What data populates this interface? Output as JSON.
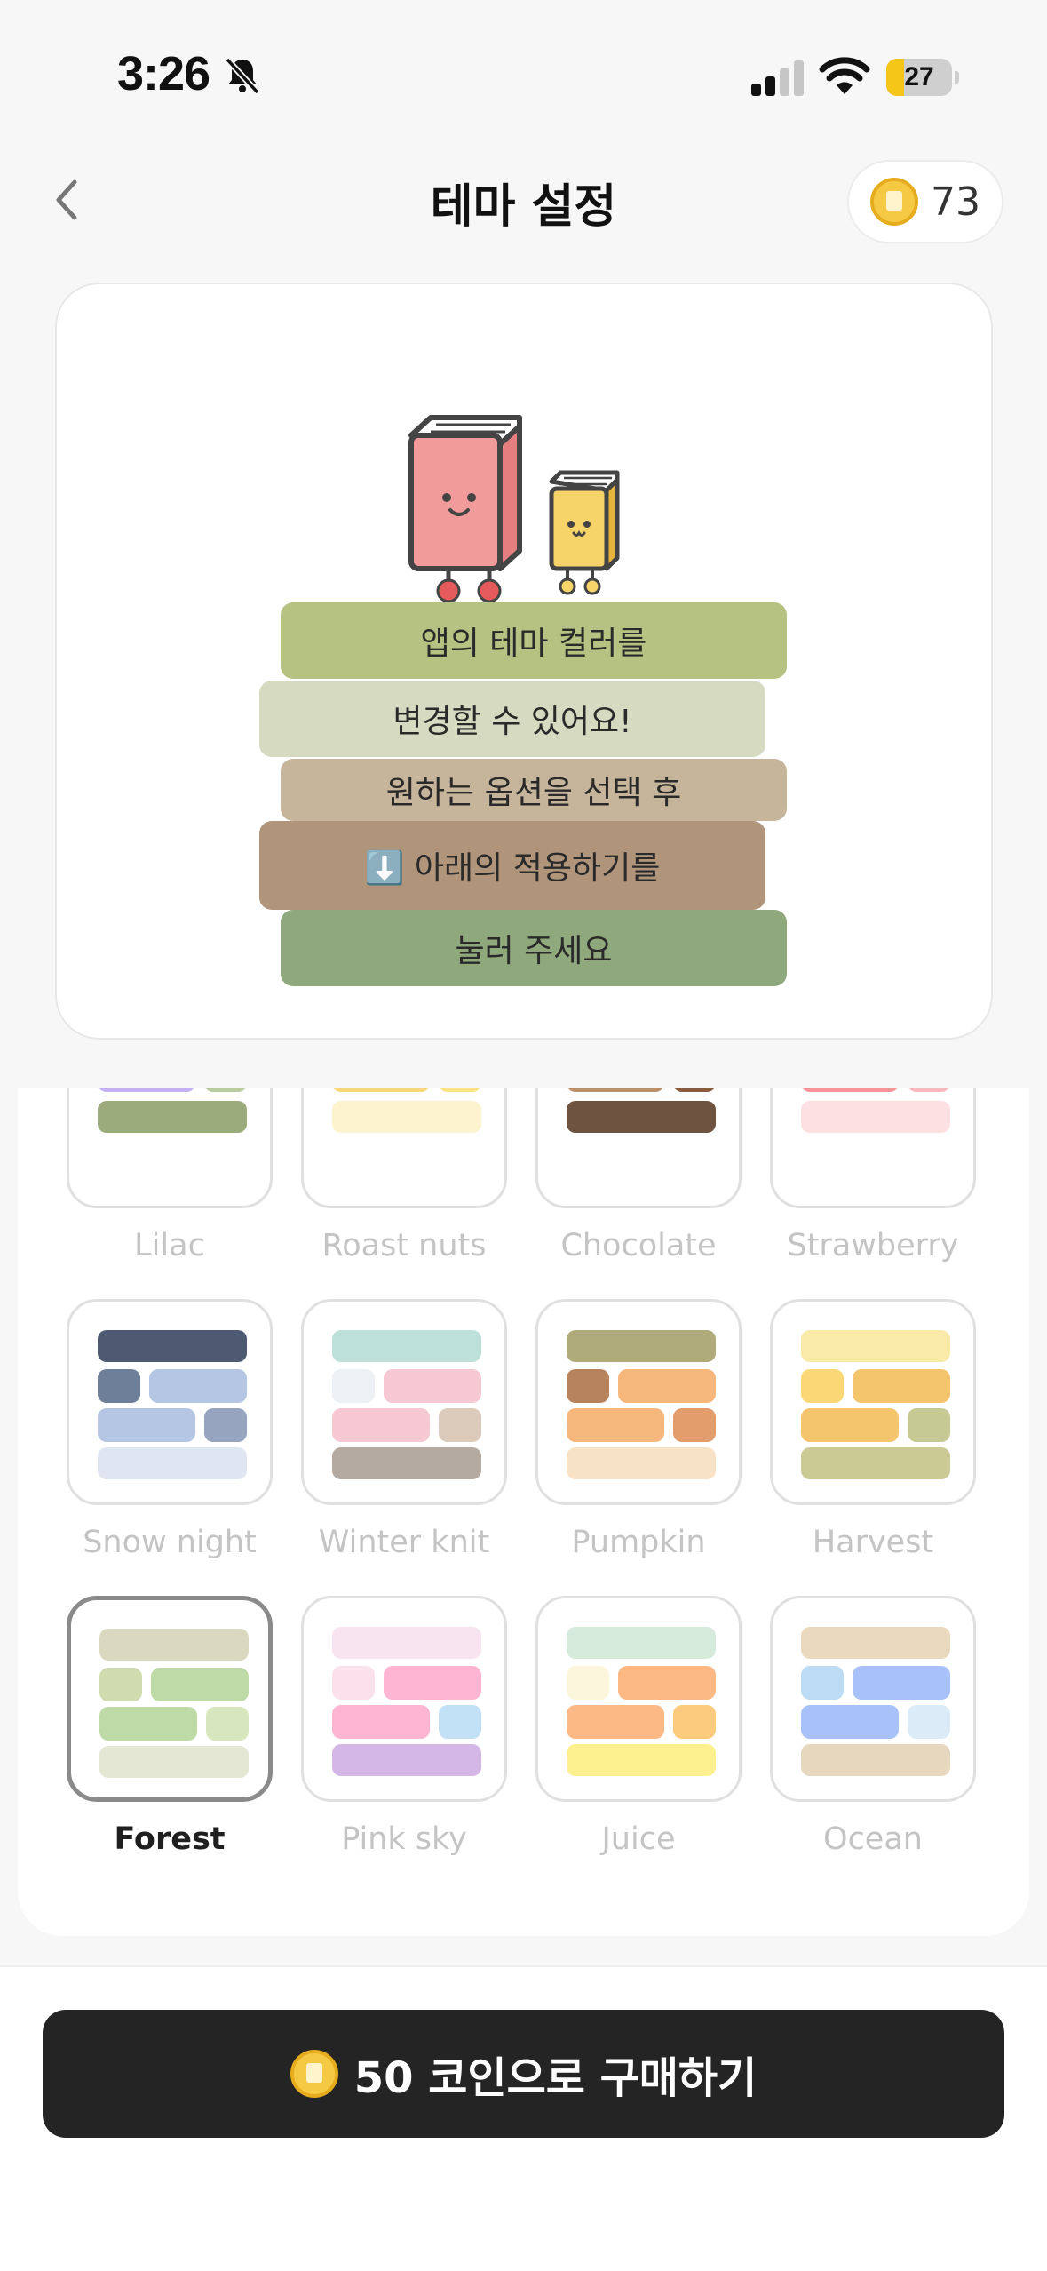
{
  "status_bar": {
    "time": "3:26",
    "battery": "27",
    "battery_level": 0.27,
    "icons": [
      "bell-slash-icon",
      "cellular-signal-icon",
      "wifi-icon",
      "battery-icon"
    ]
  },
  "header": {
    "title": "테마 설정",
    "back_icon": "chevron-left-icon",
    "coin_count": "73"
  },
  "preview": {
    "lines": [
      "앱의 테마 컬러를",
      "변경할 수 있어요!",
      "원하는 옵션을 선택 후",
      "⬇️ 아래의 적용하기를",
      "눌러 주세요"
    ],
    "bar_colors": [
      "#b5c281",
      "#d5dac0",
      "#c6b59a",
      "#b0957b",
      "#90a97c"
    ]
  },
  "themes": [
    {
      "name": "Lilac",
      "selected": false,
      "colors": [
        "#ddd5f0",
        "#c4b1f4",
        "#c4b1f4",
        "#bacb9e",
        "#9bab7c"
      ]
    },
    {
      "name": "Roast nuts",
      "selected": false,
      "colors": [
        "#d8b58a",
        "#f8d779",
        "#f8d779",
        "#fbe383",
        "#fdf4cf"
      ]
    },
    {
      "name": "Chocolate",
      "selected": false,
      "colors": [
        "#e3c9ad",
        "#bb8f6a",
        "#bb8f6a",
        "#8a5a3c",
        "#6f5341"
      ]
    },
    {
      "name": "Strawberry",
      "selected": false,
      "colors": [
        "#a4b57b",
        "#f8939a",
        "#f8939a",
        "#fbb8bc",
        "#fde1e2"
      ]
    },
    {
      "name": "Snow night",
      "selected": false,
      "colors": [
        "#4e5a71",
        "#6e7f99",
        "#b4c6e3",
        "#b4c6e3",
        "#96a4c0",
        "#dfe5f1"
      ]
    },
    {
      "name": "Winter knit",
      "selected": false,
      "colors": [
        "#bde0d9",
        "#edf0f4",
        "#f5c8d2",
        "#f5c8d2",
        "#dccabb",
        "#b5aaa1"
      ]
    },
    {
      "name": "Pumpkin",
      "selected": false,
      "colors": [
        "#b0ab7b",
        "#b6835c",
        "#f6b77d",
        "#f6b77d",
        "#e39d6d",
        "#f8e2c5"
      ]
    },
    {
      "name": "Harvest",
      "selected": false,
      "colors": [
        "#faeaa9",
        "#fbd775",
        "#f4c56d",
        "#f4c56d",
        "#c7c994",
        "#cbc994"
      ]
    },
    {
      "name": "Forest",
      "selected": true,
      "colors": [
        "#dbd8c0",
        "#d0dbb0",
        "#bedaa6",
        "#bedaa6",
        "#d7e6bd",
        "#e3e7d3"
      ]
    },
    {
      "name": "Pink sky",
      "selected": false,
      "colors": [
        "#f8e4f1",
        "#fae1eb",
        "#fdb5d1",
        "#fdb5d1",
        "#c3e1f6",
        "#d4b7e6"
      ]
    },
    {
      "name": "Juice",
      "selected": false,
      "colors": [
        "#d6ebdc",
        "#fbf6dc",
        "#fdb985",
        "#fdb985",
        "#fccb7d",
        "#fdf08f"
      ]
    },
    {
      "name": "Ocean",
      "selected": false,
      "colors": [
        "#ead9bf",
        "#bcdcf6",
        "#a9c1f9",
        "#a9c1f9",
        "#dcebf8",
        "#e7d7bf"
      ]
    }
  ],
  "buy_button": {
    "label": "50 코인으로 구매하기",
    "icon": "coin-icon"
  },
  "colors": {
    "background": "#f7f7f7",
    "button_bg": "#242424",
    "coin": "#f6c945",
    "muted_label": "#c4c4c4"
  }
}
